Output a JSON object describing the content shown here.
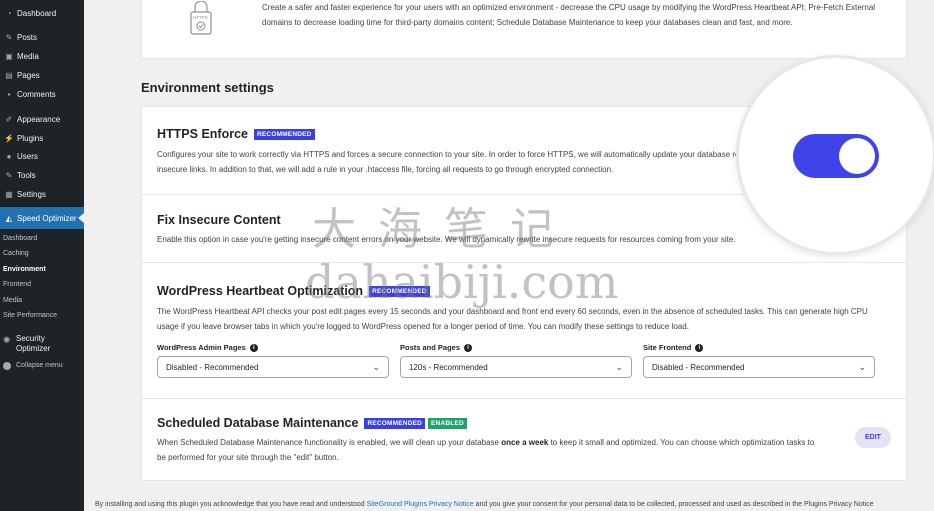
{
  "sidebar": {
    "items": [
      {
        "label": "Dashboard",
        "icon": "dashboard-icon"
      },
      {
        "label": "Posts",
        "icon": "pin-icon"
      },
      {
        "label": "Media",
        "icon": "media-icon"
      },
      {
        "label": "Pages",
        "icon": "pages-icon"
      },
      {
        "label": "Comments",
        "icon": "comment-icon"
      },
      {
        "label": "Appearance",
        "icon": "brush-icon"
      },
      {
        "label": "Plugins",
        "icon": "plugin-icon"
      },
      {
        "label": "Users",
        "icon": "user-icon"
      },
      {
        "label": "Tools",
        "icon": "wrench-icon"
      },
      {
        "label": "Settings",
        "icon": "settings-icon"
      },
      {
        "label": "Speed Optimizer",
        "icon": "speed-icon"
      }
    ],
    "submenu": [
      "Dashboard",
      "Caching",
      "Environment",
      "Frontend",
      "Media",
      "Site Performance"
    ],
    "security_line1": "Security",
    "security_line2": "Optimizer",
    "collapse": "Collapse menu"
  },
  "intro": {
    "text": "Create a safer and faster experience for your users with an optimized environment - decrease the CPU usage by modifying the WordPress Heartbeat API; Pre-Fetch External domains to decrease loading time for third-party domains content; Schedule Database Maintenance to keep your databases clean and fast, and more.",
    "icon_label": "HTTPS"
  },
  "section_title": "Environment settings",
  "https": {
    "title": "HTTPS Enforce",
    "badge": "RECOMMENDED",
    "desc": "Configures your site to work correctly via HTTPS and forces a secure connection to your site. In order to force HTTPS, we will automatically update your database replacing all insecure links. In addition to that, we will add a rule in your .htaccess file, forcing all requests to go through encrypted connection.",
    "enabled": true
  },
  "insecure": {
    "title": "Fix Insecure Content",
    "desc": "Enable this option in case you're getting insecure content errors on your website. We will dynamically rewrite insecure requests for resources coming from your site."
  },
  "heartbeat": {
    "title": "WordPress Heartbeat Optimization",
    "badge": "RECOMMENDED",
    "desc": "The WordPress Heartbeat API checks your post edit pages every 15 seconds and your dashboard and front end every 60 seconds, even in the absence of scheduled tasks. This can generate high CPU usage if you leave browser tabs in which you're logged to WordPress opened for a longer period of time. You can modify these settings to reduce load.",
    "selects": [
      {
        "label": "WordPress Admin Pages",
        "value": "Disabled - Recommended"
      },
      {
        "label": "Posts and Pages",
        "value": "120s - Recommended"
      },
      {
        "label": "Site Frontend",
        "value": "Disabled - Recommended"
      }
    ]
  },
  "db": {
    "title": "Scheduled Database Maintenance",
    "badge1": "RECOMMENDED",
    "badge2": "ENABLED",
    "desc_a": "When Scheduled Database Maintenance functionality is enabled, we will clean up your database ",
    "desc_b": "once a week",
    "desc_c": " to keep it small and optimized. You can choose which optimization tasks to be performed for your site through the \"edit\" button.",
    "edit": "EDIT"
  },
  "footer": {
    "before": "By installing and using this plugin you acknowledge that you have read and understood ",
    "link": "SiteGround Plugins Privacy Notice",
    "after": " and you give your consent for your personal data to be collected, processed and used as described in the Plugins Privacy Notice"
  },
  "watermark": {
    "cn": "大海笔记",
    "en": "dahaibiji.com"
  },
  "colors": {
    "accent": "#3e44e8",
    "sidebar_bg": "#1d2327",
    "active_menu": "#2271b1",
    "enabled_badge": "#1fa36b"
  }
}
